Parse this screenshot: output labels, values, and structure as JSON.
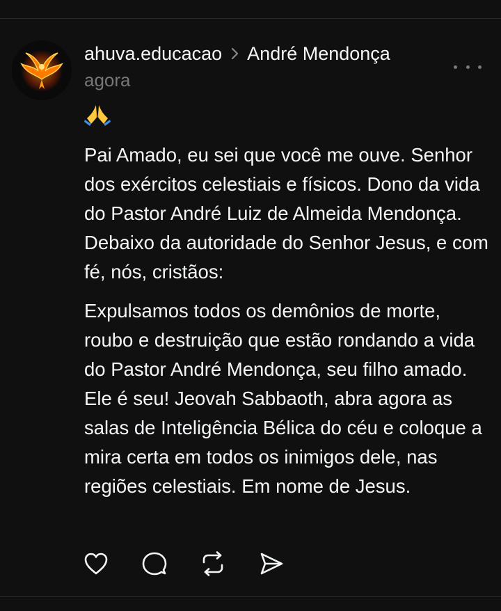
{
  "post": {
    "author": "ahuva.educacao",
    "thread_target": "André Mendonça",
    "timestamp": "agora",
    "emoji": "🙏",
    "paragraphs": [
      "Pai Amado, eu sei que você me ouve. Senhor dos exércitos celestiais e físicos. Dono da vida do Pastor André Luiz de Almeida Mendonça. Debaixo da autoridade do Senhor Jesus, e com fé, nós, cristãos:",
      "Expulsamos todos os demônios de morte, roubo e destruição que estão rondando a vida do Pastor André Mendonça, seu filho amado. Ele é seu! Jeovah Sabbaoth, abra agora as salas de Inteligência Bélica do céu e coloque a mira certa em todos os inimigos dele, nas regiões celestiais. Em nome de Jesus."
    ]
  },
  "icons": {
    "avatar": "flaming-bird-avatar",
    "separator": "chevron-right-icon",
    "more": "more-horizontal-icon",
    "actions": [
      "heart-icon",
      "comment-icon",
      "repost-icon",
      "share-icon"
    ]
  },
  "colors": {
    "background": "#101010",
    "text_primary": "#f3f5f7",
    "text_secondary": "#777777",
    "divider": "#2a2a2a",
    "avatar_flame": "#ff7a00"
  }
}
